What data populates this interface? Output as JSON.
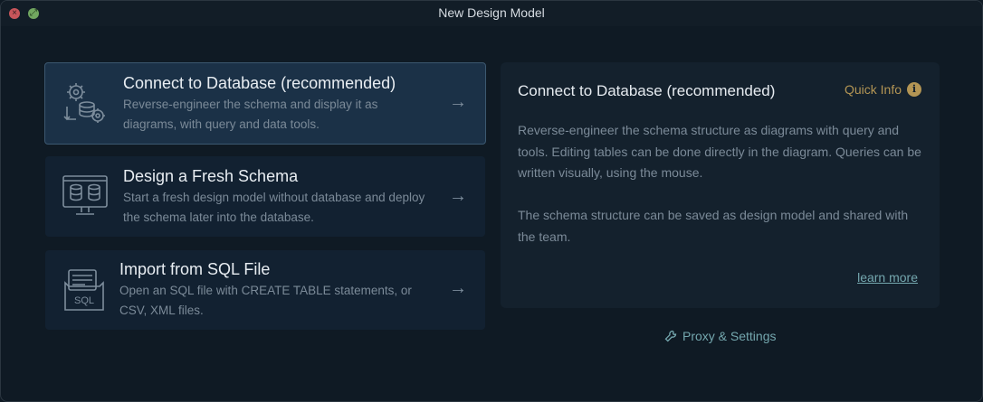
{
  "window": {
    "title": "New Design Model"
  },
  "options": [
    {
      "title": "Connect to Database (recommended)",
      "description": "Reverse-engineer the schema and display it as diagrams, with query and data tools.",
      "icon": "database-gears-icon",
      "selected": true
    },
    {
      "title": "Design a Fresh Schema",
      "description": "Start a fresh design model without database and deploy the schema later into the database.",
      "icon": "monitor-database-icon",
      "selected": false
    },
    {
      "title": "Import from SQL File",
      "description": "Open an SQL file with CREATE TABLE statements, or CSV, XML files.",
      "icon": "sql-file-icon",
      "icon_label": "SQL",
      "selected": false
    }
  ],
  "arrow_glyph": "→",
  "info_panel": {
    "title": "Connect to Database (recommended)",
    "quick_info_label": "Quick Info",
    "paragraph1": "Reverse-engineer the schema structure as diagrams with query and tools.  Editing tables can be done directly in the diagram. Queries can be written visually, using the mouse.",
    "paragraph2": "The schema structure can be saved as design model and shared with the team.",
    "learn_more": "learn more"
  },
  "proxy_settings_label": "Proxy & Settings",
  "colors": {
    "accent": "#74a7ae",
    "quick_info": "#b39554",
    "selected_card": "#1b3147"
  }
}
